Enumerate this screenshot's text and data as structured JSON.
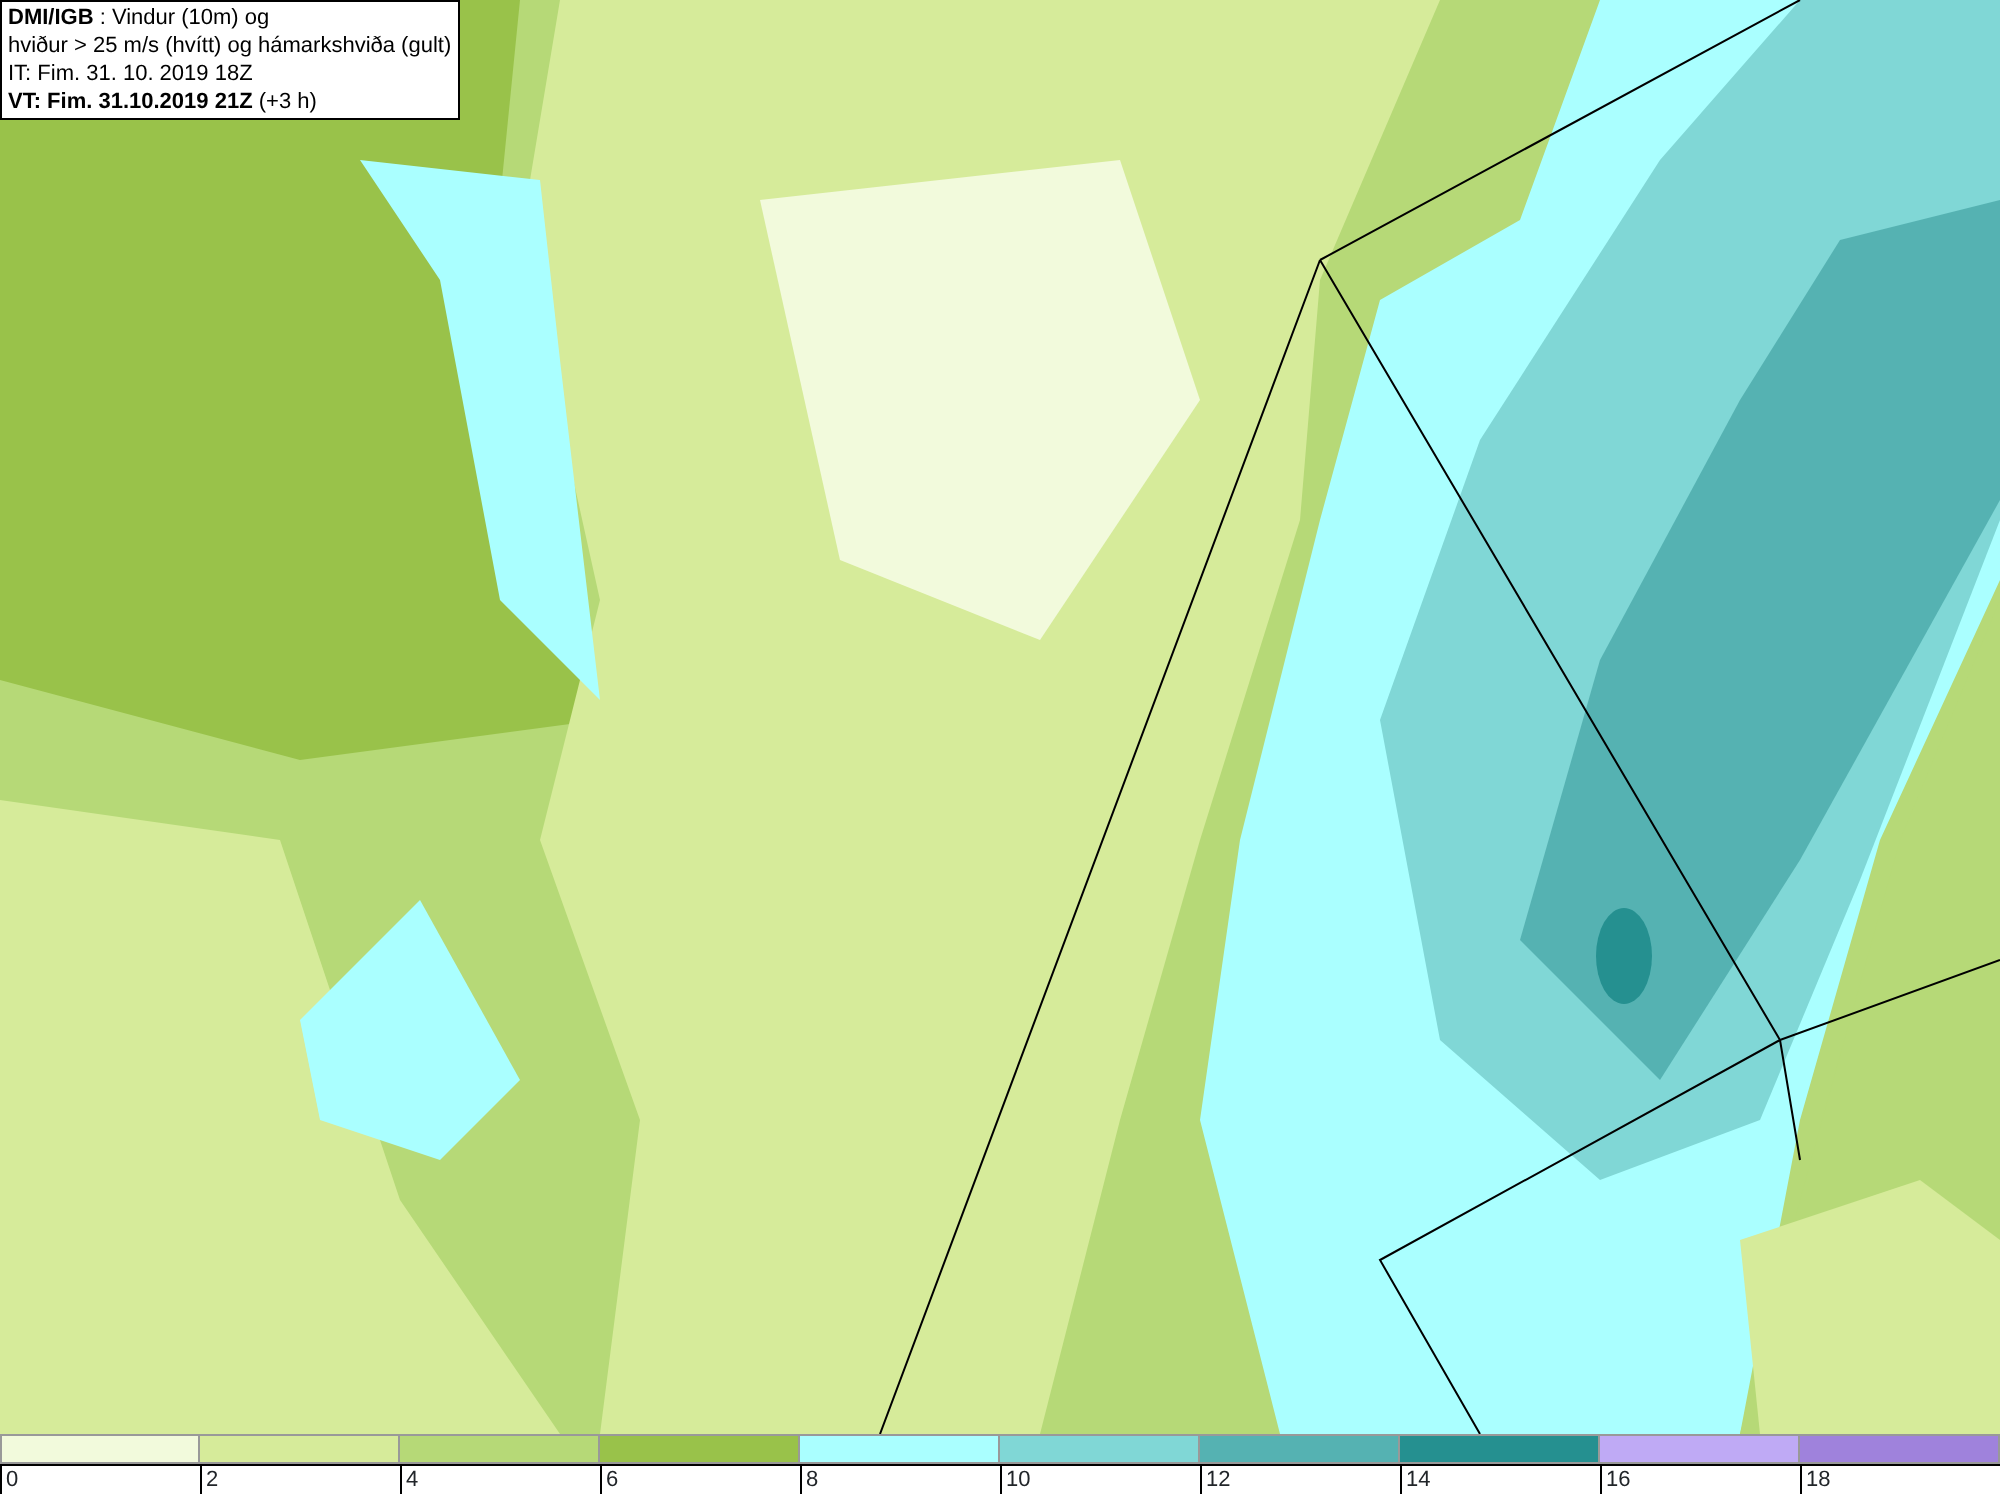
{
  "title_box": {
    "lines": [
      "**DMI/IGB** : Vindur (10m) og",
      "hviður > 25 m/s (hvítt) og hámarkshviða (gult)",
      "IT: Fim. 31. 10. 2019 18Z",
      "**VT: Fim. 31.10.2019 21Z** (+3 h)"
    ]
  },
  "legend": {
    "segments": [
      {
        "label": "0",
        "color": "#f2fadc"
      },
      {
        "label": "2",
        "color": "#d6eb9a"
      },
      {
        "label": "4",
        "color": "#b6d977"
      },
      {
        "label": "6",
        "color": "#99c24a"
      },
      {
        "label": "8",
        "color": "#aaffff"
      },
      {
        "label": "10",
        "color": "#80d7d6"
      },
      {
        "label": "12",
        "color": "#55b2b2"
      },
      {
        "label": "14",
        "color": "#259090"
      },
      {
        "label": "16",
        "color": "#bfaaf5"
      },
      {
        "label": "18",
        "color": "#9f82dc"
      }
    ]
  }
}
